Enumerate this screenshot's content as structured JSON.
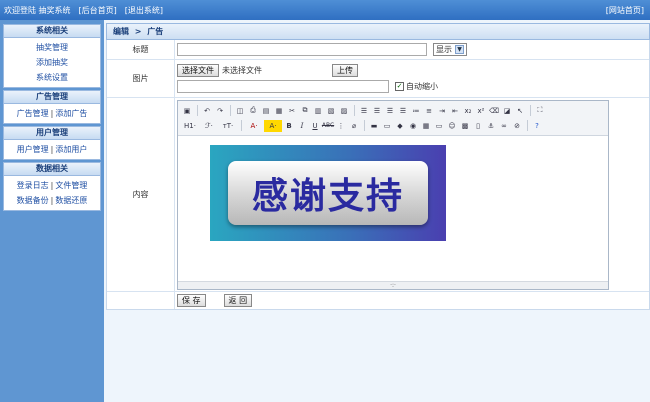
{
  "topbar": {
    "welcome": "欢迎登陆 抽奖系统",
    "admin_home": "[后台首页]",
    "logout": "[退出系统]",
    "site_home": "[网站首页]"
  },
  "sidebar": {
    "sections": [
      {
        "title": "系统相关",
        "items": [
          "抽奖管理",
          "添加抽奖",
          "系统设置"
        ]
      },
      {
        "title": "广告管理",
        "items": [
          "广告管理",
          "添加广告"
        ]
      },
      {
        "title": "用户管理",
        "items": [
          "用户管理",
          "添加用户"
        ]
      },
      {
        "title": "数据相关",
        "items": [
          "登录日志",
          "文件管理",
          "数据备份",
          "数据还原"
        ]
      }
    ],
    "separator": "|"
  },
  "breadcrumb": {
    "first": "编辑",
    "arrow": ">",
    "second": "广告"
  },
  "form": {
    "title_label": "标题",
    "title_value": "",
    "display_select": "显示",
    "image_label": "图片",
    "choose_file": "选择文件",
    "no_file": "未选择文件",
    "upload": "上传",
    "image_path": "",
    "auto_shrink": "自动缩小",
    "auto_shrink_checked": true,
    "content_label": "内容",
    "save": "保 存",
    "back": "返 回"
  },
  "editor": {
    "toolbar_row2_labels": {
      "heading": "H1·",
      "font": "ℱ·",
      "size": "тT·",
      "color": "A·",
      "bg": "A·"
    },
    "banner_text": "感谢支持",
    "resize_grip": "·:·"
  }
}
